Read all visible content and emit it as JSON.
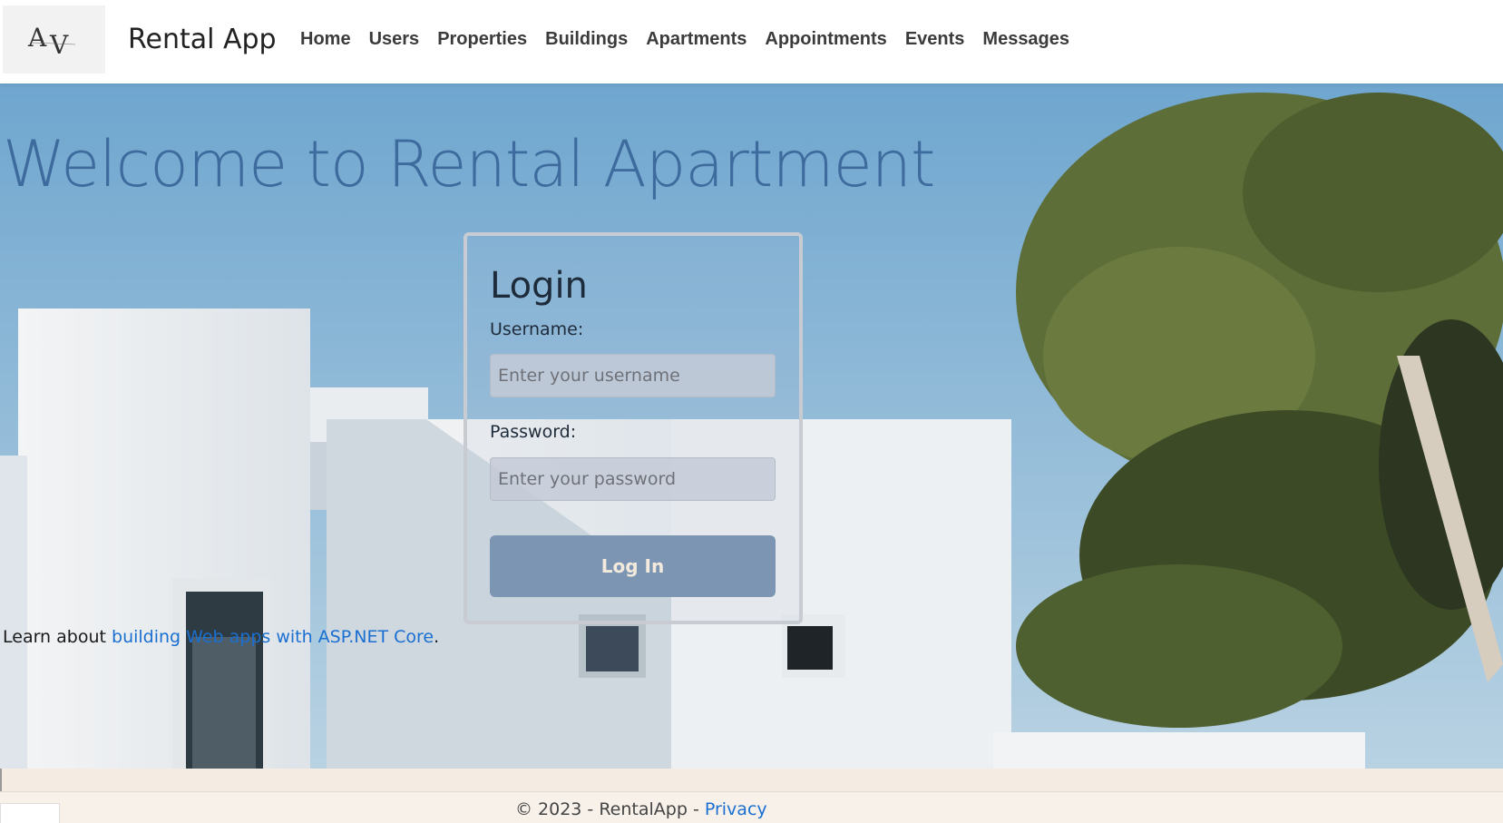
{
  "brand": {
    "name": "Rental App",
    "logo_icon": "av-logo-icon"
  },
  "nav": {
    "items": [
      {
        "label": "Home"
      },
      {
        "label": "Users"
      },
      {
        "label": "Properties"
      },
      {
        "label": "Buildings"
      },
      {
        "label": "Apartments"
      },
      {
        "label": "Appointments"
      },
      {
        "label": "Events"
      },
      {
        "label": "Messages"
      }
    ]
  },
  "hero": {
    "heading": "Welcome to Rental Apartment"
  },
  "login": {
    "title": "Login",
    "username_label": "Username:",
    "username_placeholder": "Enter your username",
    "password_label": "Password:",
    "password_placeholder": "Enter your password",
    "submit_label": "Log In"
  },
  "learn": {
    "prefix": "Learn about ",
    "link_text": "building Web apps with ASP.NET Core",
    "suffix": "."
  },
  "footer": {
    "copyright": "© 2023 - RentalApp - ",
    "privacy_label": "Privacy"
  },
  "colors": {
    "heading": "#3d6b9e",
    "link": "#1a6fd1",
    "button": "#7b95b2",
    "sky": "#7fb2d6"
  }
}
